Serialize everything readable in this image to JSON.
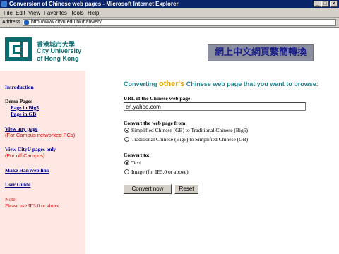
{
  "window": {
    "title": "Conversion of Chinese web pages - Microsoft Internet Explorer",
    "controls": [
      "_",
      "□",
      "×"
    ]
  },
  "menu": [
    "File",
    "Edit",
    "View",
    "Favorites",
    "Tools",
    "Help"
  ],
  "address": {
    "label": "Address",
    "url": "http://www.cityu.edu.hk/hanweb/"
  },
  "header": {
    "university_zh": "香港城市大學",
    "university_en_line1": "City University",
    "university_en_line2": "of Hong Kong",
    "banner": "網上中文網頁繁簡轉換",
    "brand_color": "#0d6b6e"
  },
  "sidebar": {
    "introduction": "Introduction",
    "demo_pages_label": "Demo Pages",
    "page_big5": "Page in Big5",
    "page_gb": "Page in GB",
    "view_any_page": "View any page",
    "view_any_note": "(For Campus networked PCs)",
    "view_cityu": "View CityU pages only",
    "view_cityu_note": "(For off Campus)",
    "make_link": "Make HanWeb link",
    "user_guide": "User Guide",
    "note_label": "Note:",
    "note_text": "Please use IE5.0 or above"
  },
  "form": {
    "heading_pre": "Converting ",
    "heading_highlight": "other's",
    "heading_post": " Chinese web page that you want to browse:",
    "url_label": "URL of the Chinese web page:",
    "url_value": "cn.yahoo.com",
    "convert_from_label": "Convert the web page from:",
    "option_gb_to_big5": "Simplified Chinese (GB) to Traditional Chinese (Big5)",
    "option_big5_to_gb": "Traditional Chinese (Big5) to Simplified Chinese (GB)",
    "convert_to_label": "Convert to:",
    "option_text": "Text",
    "option_image": "Image  (for IE5.0 or above)",
    "convert_button": "Convert now",
    "reset_button": "Reset",
    "selected_conversion": "Simplified Chinese (GB) to Traditional Chinese (Big5)",
    "selected_output": "Text"
  },
  "colors": {
    "title_bar": "#0a246a",
    "sidebar_bg": "#ffe8e4",
    "heading": "#1b7f86",
    "highlight": "#e8a300",
    "banner_bg": "#8b8fa0",
    "banner_text": "#1b1f8a",
    "note_red": "#cc0000"
  }
}
